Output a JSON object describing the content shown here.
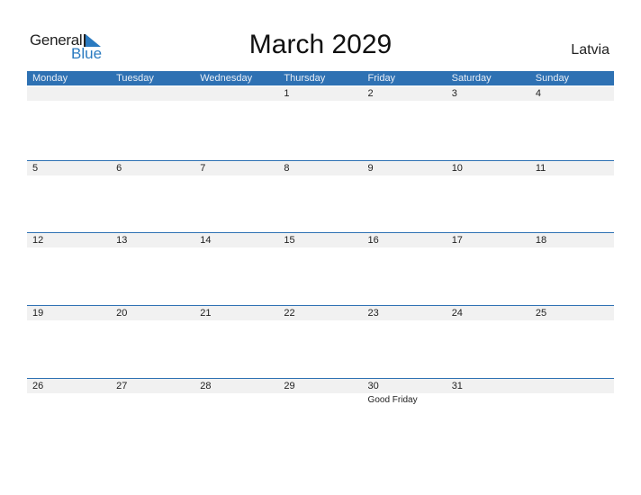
{
  "logo": {
    "general": "General",
    "blue": "Blue",
    "accent": "#2a7ac0"
  },
  "title": "March 2029",
  "country": "Latvia",
  "header_color": "#2e71b3",
  "days": [
    "Monday",
    "Tuesday",
    "Wednesday",
    "Thursday",
    "Friday",
    "Saturday",
    "Sunday"
  ],
  "weeks": [
    [
      {
        "d": ""
      },
      {
        "d": ""
      },
      {
        "d": ""
      },
      {
        "d": "1"
      },
      {
        "d": "2"
      },
      {
        "d": "3"
      },
      {
        "d": "4"
      }
    ],
    [
      {
        "d": "5"
      },
      {
        "d": "6"
      },
      {
        "d": "7"
      },
      {
        "d": "8"
      },
      {
        "d": "9"
      },
      {
        "d": "10"
      },
      {
        "d": "11"
      }
    ],
    [
      {
        "d": "12"
      },
      {
        "d": "13"
      },
      {
        "d": "14"
      },
      {
        "d": "15"
      },
      {
        "d": "16"
      },
      {
        "d": "17"
      },
      {
        "d": "18"
      }
    ],
    [
      {
        "d": "19"
      },
      {
        "d": "20"
      },
      {
        "d": "21"
      },
      {
        "d": "22"
      },
      {
        "d": "23"
      },
      {
        "d": "24"
      },
      {
        "d": "25"
      }
    ],
    [
      {
        "d": "26"
      },
      {
        "d": "27"
      },
      {
        "d": "28"
      },
      {
        "d": "29"
      },
      {
        "d": "30",
        "holiday": "Good Friday"
      },
      {
        "d": "31"
      },
      {
        "d": ""
      }
    ]
  ]
}
